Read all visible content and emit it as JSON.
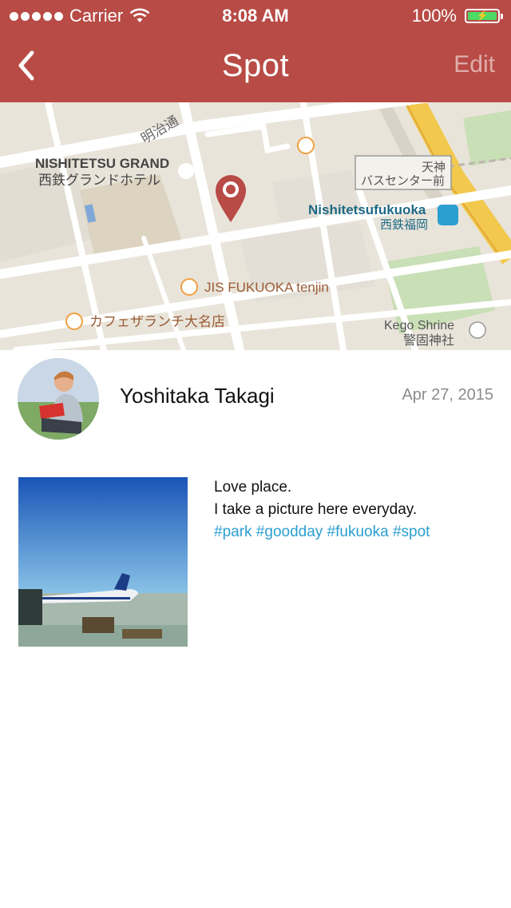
{
  "status_bar": {
    "carrier": "Carrier",
    "time": "8:08 AM",
    "battery": "100%"
  },
  "nav": {
    "title": "Spot",
    "edit_label": "Edit",
    "back_icon": "chevron-left-icon"
  },
  "map": {
    "labels": {
      "grand_en": "NISHITETSU GRAND",
      "grand_jp": "西鉄グランドホテル",
      "meiji": "明治通",
      "bus_1": "天神",
      "bus_2": "バスセンター前",
      "station_en": "Nishitetsufukuoka",
      "station_jp": "西鉄福岡",
      "jis": "JIS FUKUOKA tenjin",
      "cafe": "カフェザランチ大名店",
      "shrine_en": "Kego Shrine",
      "shrine_jp": "警固神社"
    },
    "pin_icon": "map-pin-icon"
  },
  "profile": {
    "name": "Yoshitaka Takagi",
    "date": "Apr 27, 2015"
  },
  "post": {
    "line1": "Love place.",
    "line2": "I take a picture here everyday.",
    "tags": "#park #goodday #fukuoka #spot"
  },
  "colors": {
    "header": "#B84B46",
    "tag": "#2B9FD0",
    "battery": "#4CD964"
  }
}
